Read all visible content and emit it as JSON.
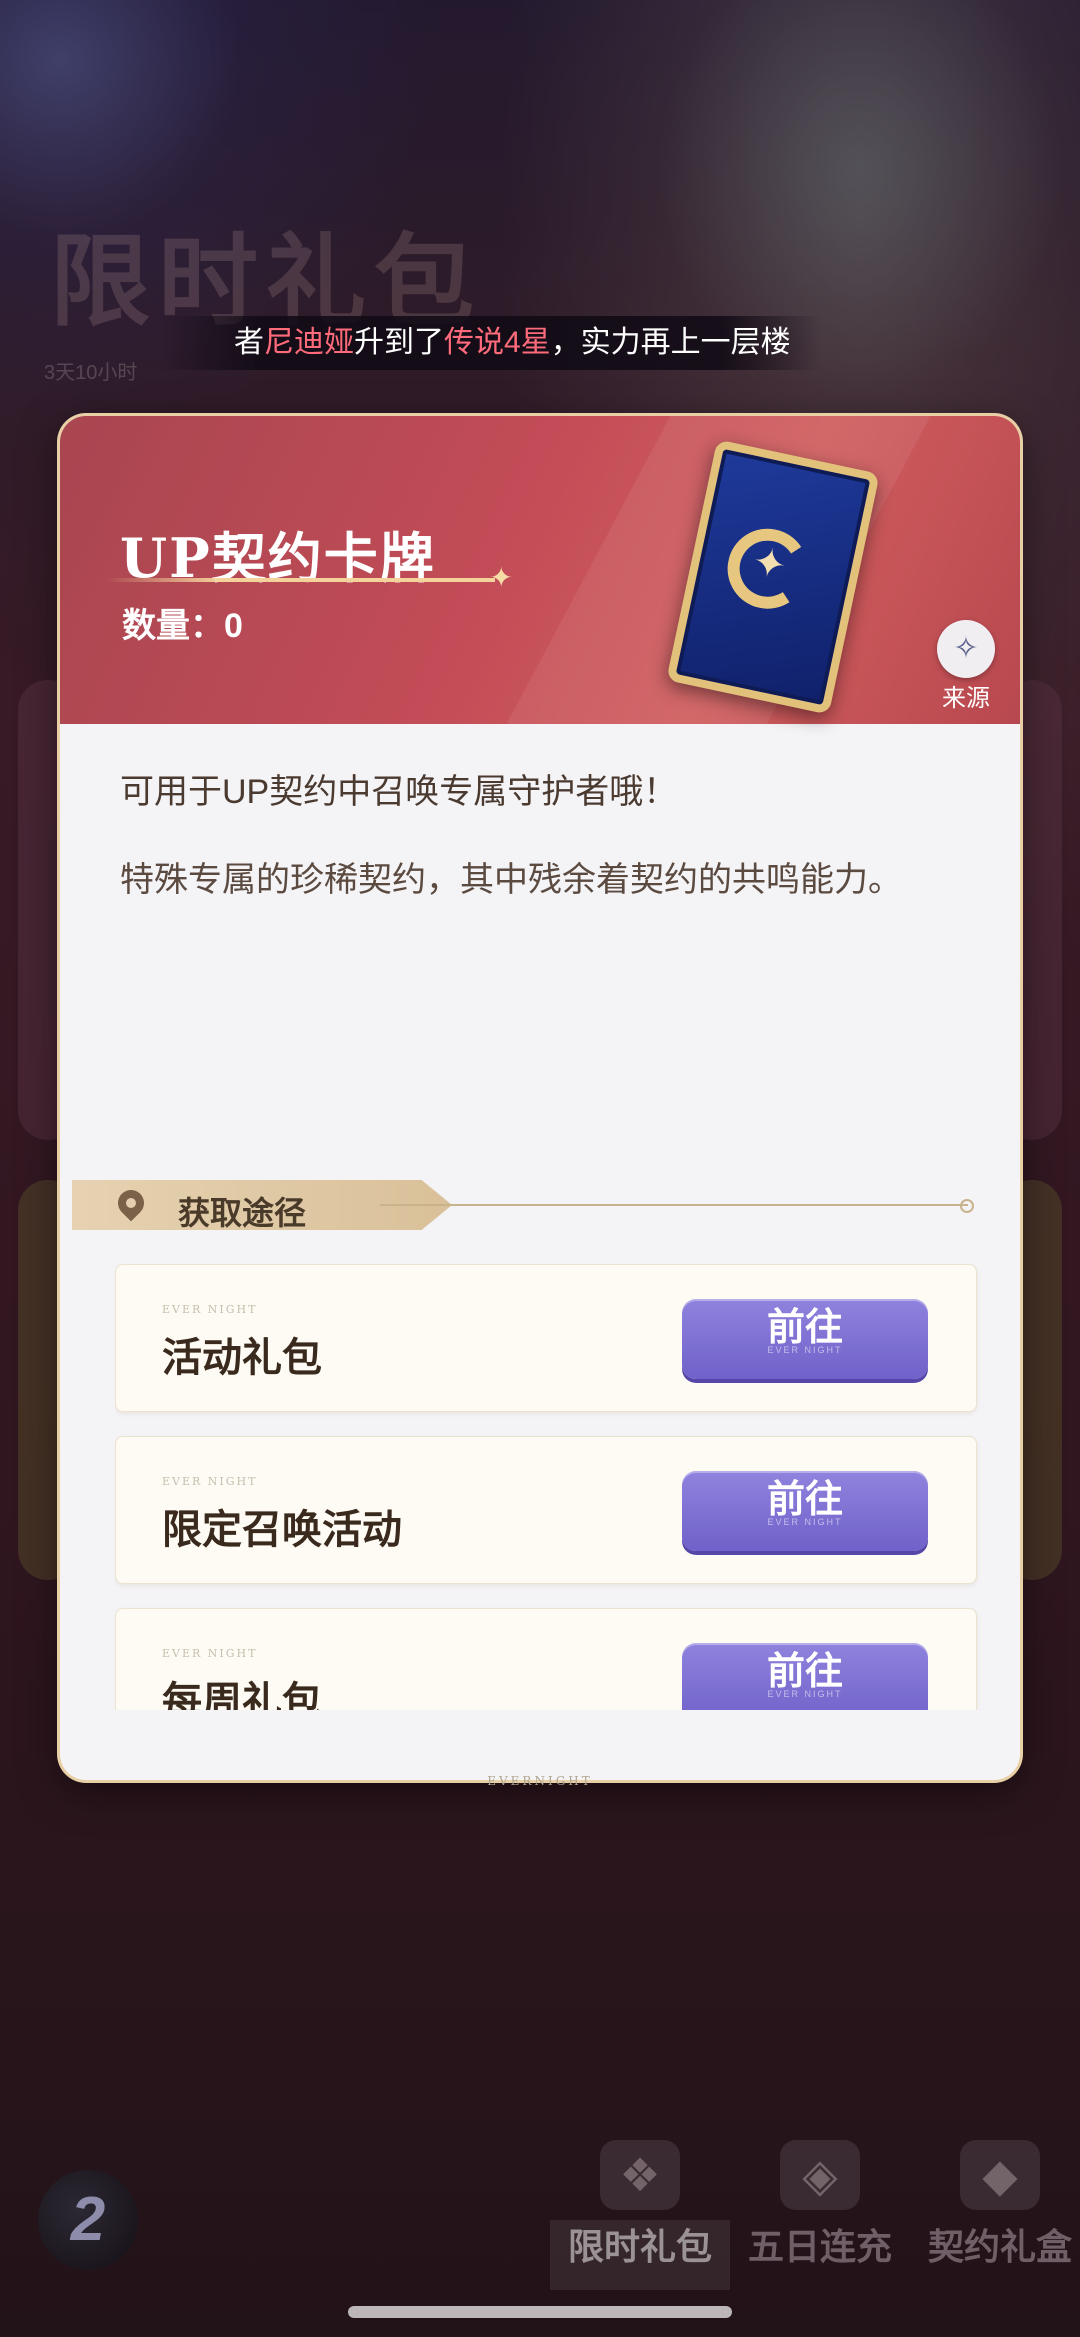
{
  "background": {
    "page_title": "限时礼包",
    "timer": "3天10小时"
  },
  "ticker": {
    "prefix": "者",
    "name": "尼迪娅",
    "mid": "升到了",
    "rank": "传说4星",
    "suffix": "，实力再上一层楼"
  },
  "card": {
    "title": "UP契约卡牌",
    "count_label": "数量：",
    "count_value": "0",
    "source_label": "来源",
    "description_1": "可用于UP契约中召唤专属守护者哦！",
    "description_2": "特殊专属的珍稀契约，其中残余着契约的共鸣能力。"
  },
  "acquire": {
    "section_title": "获取途径",
    "watermark": "EVER NIGHT",
    "items": [
      {
        "label": "活动礼包",
        "button": "前往",
        "button_sub": "EVER NIGHT"
      },
      {
        "label": "限定召唤活动",
        "button": "前往",
        "button_sub": "EVER NIGHT"
      },
      {
        "label": "每周礼包",
        "button": "前往",
        "button_sub": "EVER NIGHT"
      }
    ]
  },
  "modal_footer": "EVERNIGHT",
  "bottom_nav": {
    "logo_text": "2",
    "items": [
      {
        "label": "限时礼包",
        "active": true
      },
      {
        "label": "五日连充",
        "active": false
      },
      {
        "label": "契约礼盒",
        "active": false
      }
    ]
  },
  "colors": {
    "header_red": "#c24c57",
    "button_purple": "#7a6dd4",
    "highlight_red": "#ff6b7a",
    "gold": "#e2c27a"
  },
  "icons": [
    "location-pin-icon",
    "source-compass-icon",
    "gift-icon",
    "recharge-icon",
    "diamond-icon"
  ]
}
